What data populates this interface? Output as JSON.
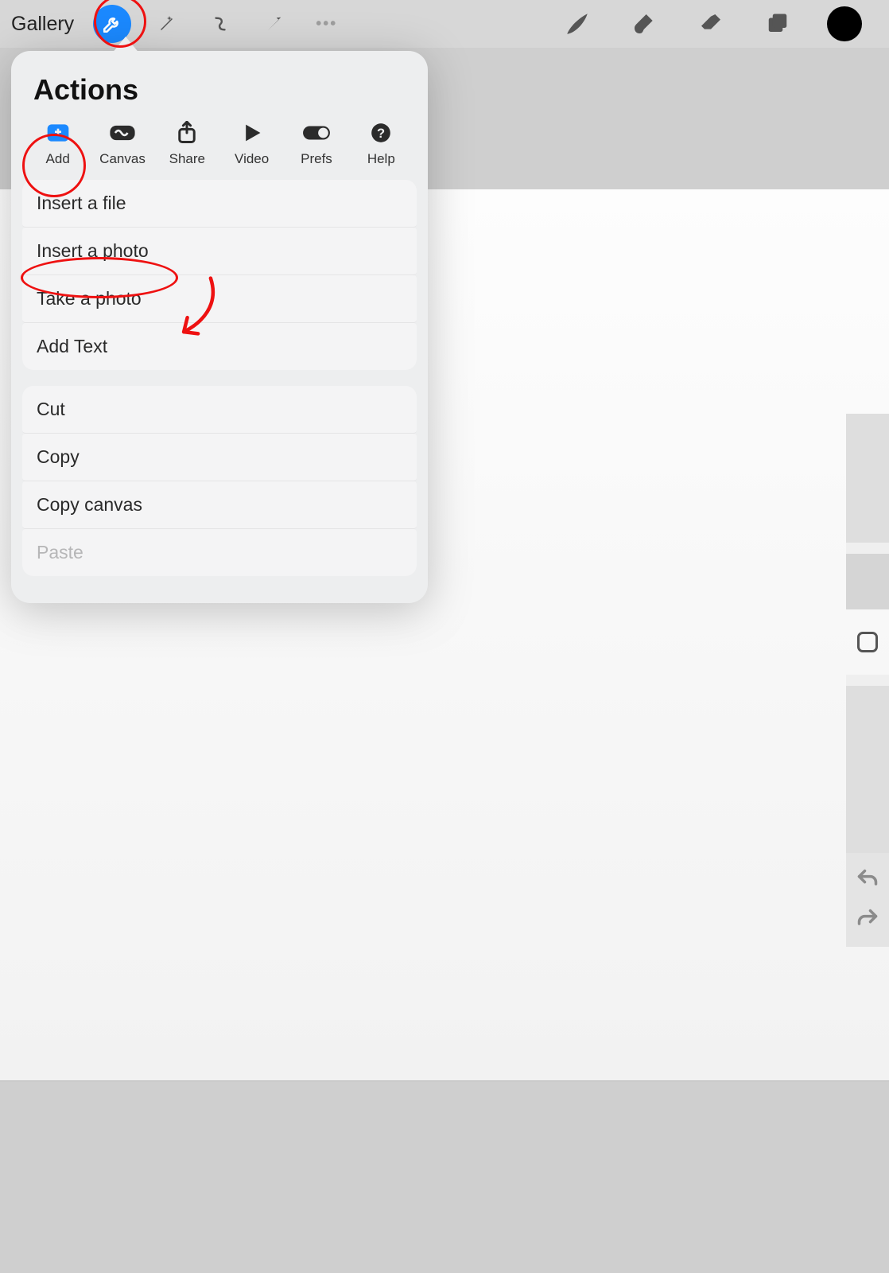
{
  "toolbar": {
    "gallery_label": "Gallery",
    "left_buttons": [
      {
        "name": "wrench-icon",
        "active": true
      },
      {
        "name": "wand-icon",
        "active": false
      },
      {
        "name": "select-icon",
        "active": false
      },
      {
        "name": "arrow-icon",
        "active": false
      }
    ],
    "right_buttons": [
      {
        "name": "brush-icon"
      },
      {
        "name": "smudge-icon"
      },
      {
        "name": "eraser-icon"
      },
      {
        "name": "layers-icon"
      }
    ],
    "color_swatch": "#000000"
  },
  "popover": {
    "title": "Actions",
    "tabs": [
      {
        "id": "add",
        "label": "Add",
        "active": true
      },
      {
        "id": "canvas",
        "label": "Canvas",
        "active": false
      },
      {
        "id": "share",
        "label": "Share",
        "active": false
      },
      {
        "id": "video",
        "label": "Video",
        "active": false
      },
      {
        "id": "prefs",
        "label": "Prefs",
        "active": false
      },
      {
        "id": "help",
        "label": "Help",
        "active": false
      }
    ],
    "groups": [
      {
        "items": [
          {
            "label": "Insert a file",
            "disabled": false
          },
          {
            "label": "Insert a photo",
            "disabled": false
          },
          {
            "label": "Take a photo",
            "disabled": false
          },
          {
            "label": "Add Text",
            "disabled": false
          }
        ]
      },
      {
        "items": [
          {
            "label": "Cut",
            "disabled": false
          },
          {
            "label": "Copy",
            "disabled": false
          },
          {
            "label": "Copy canvas",
            "disabled": false
          },
          {
            "label": "Paste",
            "disabled": true
          }
        ]
      }
    ]
  },
  "annotations": {
    "circle_wrench": true,
    "circle_add_tab": true,
    "oval_insert_photo": true,
    "arrow_to_insert_photo": true,
    "color": "#e01515"
  }
}
